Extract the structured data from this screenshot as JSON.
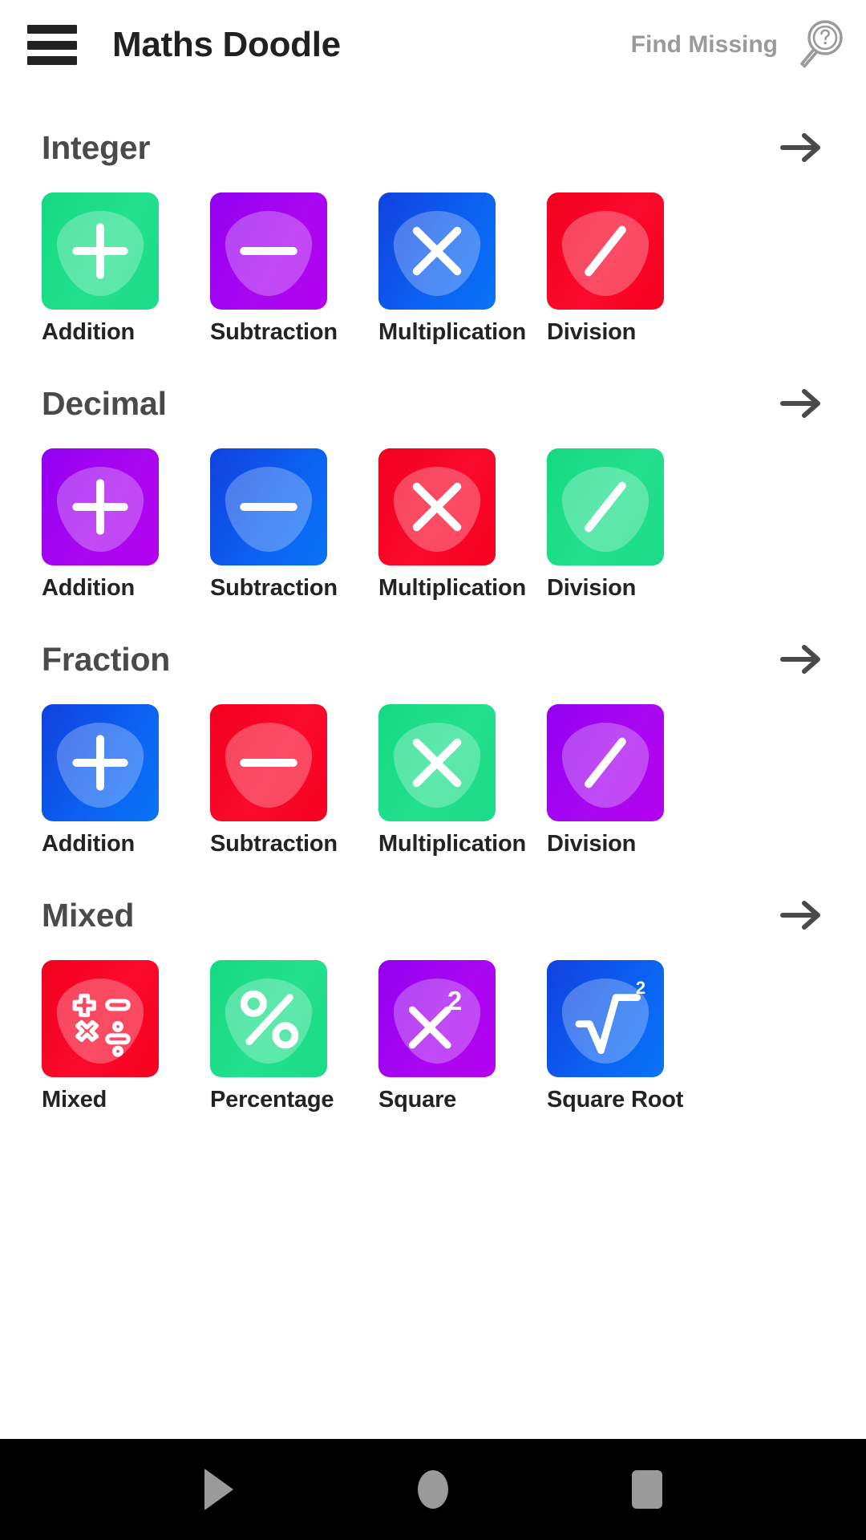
{
  "header": {
    "menu_icon": "hamburger-menu-icon",
    "title": "Maths Doodle",
    "find_missing_label": "Find Missing",
    "find_missing_icon": "magnifier-question-icon"
  },
  "colors": {
    "green": "#21DE8C",
    "purple": "#A306F0",
    "blue": "#0B5EF0",
    "red": "#F7001F",
    "text_dark": "#232323",
    "section_title": "#4A4A4A",
    "muted": "#9A9A9A",
    "background": "#FFFFFF",
    "navbar": "#000000"
  },
  "sections": [
    {
      "title": "Integer",
      "arrow_icon": "arrow-right-icon",
      "tiles": [
        {
          "label": "Addition",
          "glyph": "plus",
          "glyph_icon": "plus-icon",
          "color": "green"
        },
        {
          "label": "Subtraction",
          "glyph": "minus",
          "glyph_icon": "minus-icon",
          "color": "purple"
        },
        {
          "label": "Multiplication",
          "glyph": "times",
          "glyph_icon": "multiply-icon",
          "color": "blue"
        },
        {
          "label": "Division",
          "glyph": "slash",
          "glyph_icon": "divide-slash-icon",
          "color": "red"
        }
      ]
    },
    {
      "title": "Decimal",
      "arrow_icon": "arrow-right-icon",
      "tiles": [
        {
          "label": "Addition",
          "glyph": "plus",
          "glyph_icon": "plus-icon",
          "color": "purple"
        },
        {
          "label": "Subtraction",
          "glyph": "minus",
          "glyph_icon": "minus-icon",
          "color": "blue"
        },
        {
          "label": "Multiplication",
          "glyph": "times",
          "glyph_icon": "multiply-icon",
          "color": "red"
        },
        {
          "label": "Division",
          "glyph": "slash",
          "glyph_icon": "divide-slash-icon",
          "color": "green"
        }
      ]
    },
    {
      "title": "Fraction",
      "arrow_icon": "arrow-right-icon",
      "tiles": [
        {
          "label": "Addition",
          "glyph": "plus",
          "glyph_icon": "plus-icon",
          "color": "blue"
        },
        {
          "label": "Subtraction",
          "glyph": "minus",
          "glyph_icon": "minus-icon",
          "color": "red"
        },
        {
          "label": "Multiplication",
          "glyph": "times",
          "glyph_icon": "multiply-icon",
          "color": "green"
        },
        {
          "label": "Division",
          "glyph": "slash",
          "glyph_icon": "divide-slash-icon",
          "color": "purple"
        }
      ]
    },
    {
      "title": "Mixed",
      "arrow_icon": "arrow-right-icon",
      "tiles": [
        {
          "label": "Mixed",
          "glyph": "mixed-ops",
          "glyph_icon": "mixed-operations-icon",
          "color": "red"
        },
        {
          "label": "Percentage",
          "glyph": "percent",
          "glyph_icon": "percent-icon",
          "color": "green"
        },
        {
          "label": "Square",
          "glyph": "square",
          "glyph_icon": "x-squared-icon",
          "color": "purple"
        },
        {
          "label": "Square Root",
          "glyph": "sqrt",
          "glyph_icon": "square-root-icon",
          "color": "blue"
        }
      ]
    }
  ],
  "navbar": {
    "back_label": "Back",
    "home_label": "Home",
    "recents_label": "Recents",
    "back_icon": "nav-back-triangle-icon",
    "home_icon": "nav-home-circle-icon",
    "recents_icon": "nav-recents-square-icon"
  }
}
